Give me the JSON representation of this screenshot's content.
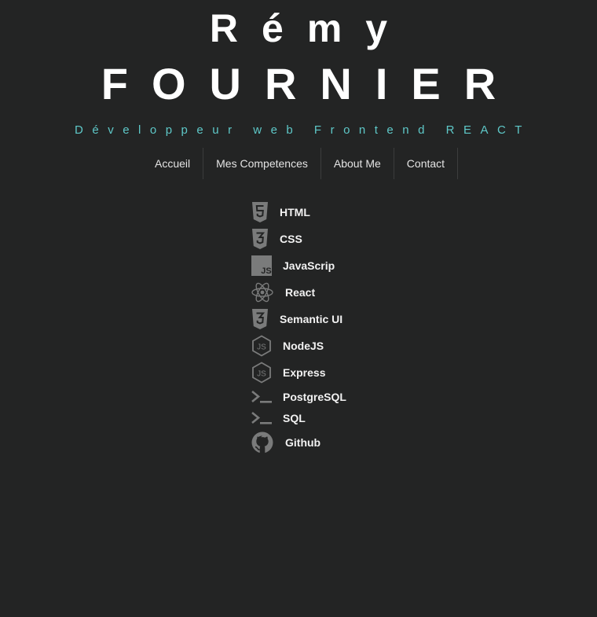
{
  "header": {
    "first_name": "Rémy",
    "last_name": "FOURNIER",
    "subtitle": "Développeur web Frontend REACT"
  },
  "nav": {
    "items": [
      {
        "label": "Accueil"
      },
      {
        "label": "Mes Competences"
      },
      {
        "label": "About Me"
      },
      {
        "label": "Contact"
      }
    ]
  },
  "skills": [
    {
      "label": "HTML",
      "icon": "html5-icon"
    },
    {
      "label": "CSS",
      "icon": "css3-icon"
    },
    {
      "label": "JavaScrip",
      "icon": "javascript-icon"
    },
    {
      "label": "React",
      "icon": "react-icon"
    },
    {
      "label": "Semantic UI",
      "icon": "css3-icon"
    },
    {
      "label": "NodeJS",
      "icon": "nodejs-icon"
    },
    {
      "label": "Express",
      "icon": "nodejs-icon"
    },
    {
      "label": "PostgreSQL",
      "icon": "terminal-icon"
    },
    {
      "label": "SQL",
      "icon": "terminal-icon"
    },
    {
      "label": "Github",
      "icon": "github-icon"
    }
  ],
  "colors": {
    "background": "#232424",
    "accent": "#5ec8c8",
    "icon": "#7a7b7b"
  }
}
